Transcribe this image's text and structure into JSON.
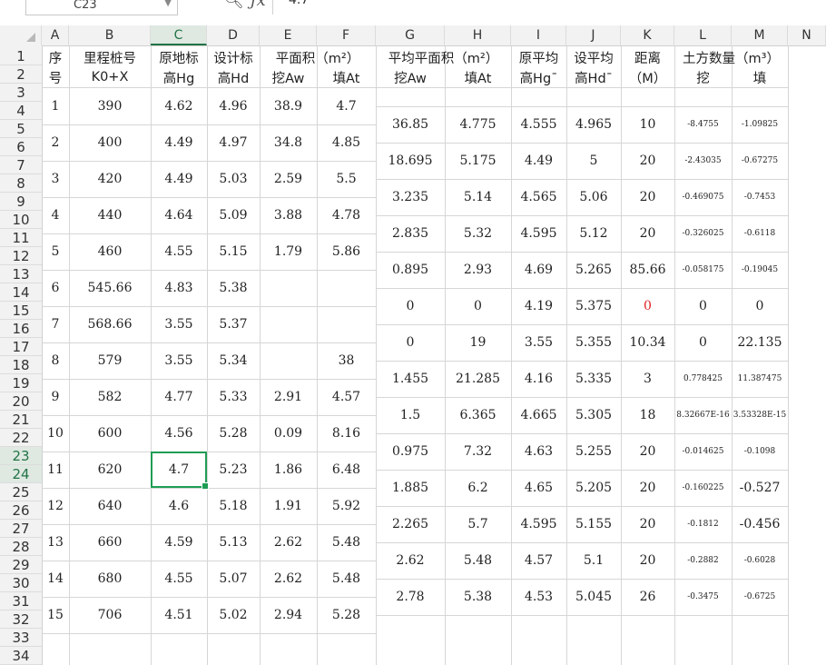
{
  "namebox": {
    "cell_ref": "C23"
  },
  "formula": {
    "value": "4.7"
  },
  "columns": [
    "A",
    "B",
    "C",
    "D",
    "E",
    "F",
    "G",
    "H",
    "I",
    "J",
    "K",
    "L",
    "M",
    "N"
  ],
  "active_column": "C",
  "rows_visible": [
    "1",
    "2",
    "3",
    "4",
    "5",
    "6",
    "7",
    "8",
    "9",
    "10",
    "11",
    "12",
    "13",
    "14",
    "15",
    "16",
    "17",
    "18",
    "19",
    "20",
    "21",
    "22",
    "23",
    "24",
    "25",
    "26",
    "27",
    "28",
    "29",
    "30",
    "31",
    "32",
    "33",
    "34"
  ],
  "active_rows": [
    "23",
    "24"
  ],
  "headers": {
    "A": [
      "序",
      "号"
    ],
    "B": [
      "里程桩号",
      "K0+X"
    ],
    "C": [
      "原地标",
      "高Hg"
    ],
    "D": [
      "设计标",
      "高Hd"
    ],
    "E": [
      "平面积（m²）",
      "挖Aw"
    ],
    "F": [
      "",
      "填At"
    ],
    "G": [
      "平均平面积（m²）",
      "挖Aw"
    ],
    "H": [
      "",
      "填At"
    ],
    "I": [
      "原平均",
      "高Hg¯"
    ],
    "J": [
      "设平均",
      "高Hd¯"
    ],
    "K": [
      "距离",
      "（M）"
    ],
    "L": [
      "土方数量（m³）",
      "挖"
    ],
    "M": [
      "",
      "填"
    ]
  },
  "left_rows": [
    {
      "no": "1",
      "station": "390",
      "hg": "4.62",
      "hd": "4.96",
      "aw": "38.9",
      "at": "4.7"
    },
    {
      "no": "2",
      "station": "400",
      "hg": "4.49",
      "hd": "4.97",
      "aw": "34.8",
      "at": "4.85"
    },
    {
      "no": "3",
      "station": "420",
      "hg": "4.49",
      "hd": "5.03",
      "aw": "2.59",
      "at": "5.5"
    },
    {
      "no": "4",
      "station": "440",
      "hg": "4.64",
      "hd": "5.09",
      "aw": "3.88",
      "at": "4.78"
    },
    {
      "no": "5",
      "station": "460",
      "hg": "4.55",
      "hd": "5.15",
      "aw": "1.79",
      "at": "5.86"
    },
    {
      "no": "6",
      "station": "545.66",
      "hg": "4.83",
      "hd": "5.38",
      "aw": "",
      "at": ""
    },
    {
      "no": "7",
      "station": "568.66",
      "hg": "3.55",
      "hd": "5.37",
      "aw": "",
      "at": ""
    },
    {
      "no": "8",
      "station": "579",
      "hg": "3.55",
      "hd": "5.34",
      "aw": "",
      "at": "38"
    },
    {
      "no": "9",
      "station": "582",
      "hg": "4.77",
      "hd": "5.33",
      "aw": "2.91",
      "at": "4.57"
    },
    {
      "no": "10",
      "station": "600",
      "hg": "4.56",
      "hd": "5.28",
      "aw": "0.09",
      "at": "8.16"
    },
    {
      "no": "11",
      "station": "620",
      "hg": "4.7",
      "hd": "5.23",
      "aw": "1.86",
      "at": "6.48"
    },
    {
      "no": "12",
      "station": "640",
      "hg": "4.6",
      "hd": "5.18",
      "aw": "1.91",
      "at": "5.92"
    },
    {
      "no": "13",
      "station": "660",
      "hg": "4.59",
      "hd": "5.13",
      "aw": "2.62",
      "at": "5.48"
    },
    {
      "no": "14",
      "station": "680",
      "hg": "4.55",
      "hd": "5.07",
      "aw": "2.62",
      "at": "5.48"
    },
    {
      "no": "15",
      "station": "706",
      "hg": "4.51",
      "hd": "5.02",
      "aw": "2.94",
      "at": "5.28"
    }
  ],
  "right_rows": [
    {
      "gaw": "36.85",
      "gat": "4.775",
      "hg": "4.555",
      "hd": "4.965",
      "dist": "10",
      "cut": "-8.4755",
      "fill": "-1.09825",
      "cut_small": true,
      "fill_small": true
    },
    {
      "gaw": "18.695",
      "gat": "5.175",
      "hg": "4.49",
      "hd": "5",
      "dist": "20",
      "cut": "-2.43035",
      "fill": "-0.67275",
      "cut_small": true,
      "fill_small": true
    },
    {
      "gaw": "3.235",
      "gat": "5.14",
      "hg": "4.565",
      "hd": "5.06",
      "dist": "20",
      "cut": "-0.469075",
      "fill": "-0.7453",
      "cut_small": true,
      "fill_small": true
    },
    {
      "gaw": "2.835",
      "gat": "5.32",
      "hg": "4.595",
      "hd": "5.12",
      "dist": "20",
      "cut": "-0.326025",
      "fill": "-0.6118",
      "cut_small": true,
      "fill_small": true
    },
    {
      "gaw": "0.895",
      "gat": "2.93",
      "hg": "4.69",
      "hd": "5.265",
      "dist": "85.66",
      "cut": "-0.058175",
      "fill": "-0.19045",
      "cut_small": true,
      "fill_small": true
    },
    {
      "gaw": "0",
      "gat": "0",
      "hg": "4.19",
      "hd": "5.375",
      "dist": "0",
      "dist_red": true,
      "cut": "0",
      "fill": "0"
    },
    {
      "gaw": "0",
      "gat": "19",
      "hg": "3.55",
      "hd": "5.355",
      "dist": "10.34",
      "cut": "0",
      "fill": "22.135"
    },
    {
      "gaw": "1.455",
      "gat": "21.285",
      "hg": "4.16",
      "hd": "5.335",
      "dist": "3",
      "cut": "0.778425",
      "fill": "11.387475",
      "cut_small": true,
      "fill_small": true
    },
    {
      "gaw": "1.5",
      "gat": "6.365",
      "hg": "4.665",
      "hd": "5.305",
      "dist": "18",
      "cut": "8.32667E-16",
      "fill": "3.53328E-15",
      "cut_small": true,
      "fill_small": true
    },
    {
      "gaw": "0.975",
      "gat": "7.32",
      "hg": "4.63",
      "hd": "5.255",
      "dist": "20",
      "cut": "-0.014625",
      "fill": "-0.1098",
      "cut_small": true,
      "fill_small": true
    },
    {
      "gaw": "1.885",
      "gat": "6.2",
      "hg": "4.65",
      "hd": "5.205",
      "dist": "20",
      "cut": "-0.160225",
      "fill": "-0.527",
      "cut_small": true
    },
    {
      "gaw": "2.265",
      "gat": "5.7",
      "hg": "4.595",
      "hd": "5.155",
      "dist": "20",
      "cut": "-0.1812",
      "fill": "-0.456",
      "cut_small": true
    },
    {
      "gaw": "2.62",
      "gat": "5.48",
      "hg": "4.57",
      "hd": "5.1",
      "dist": "20",
      "cut": "-0.2882",
      "fill": "-0.6028",
      "cut_small": true,
      "fill_small": true
    },
    {
      "gaw": "2.78",
      "gat": "5.38",
      "hg": "4.53",
      "hd": "5.045",
      "dist": "26",
      "cut": "-0.3475",
      "fill": "-0.6725",
      "cut_small": true,
      "fill_small": true
    }
  ]
}
